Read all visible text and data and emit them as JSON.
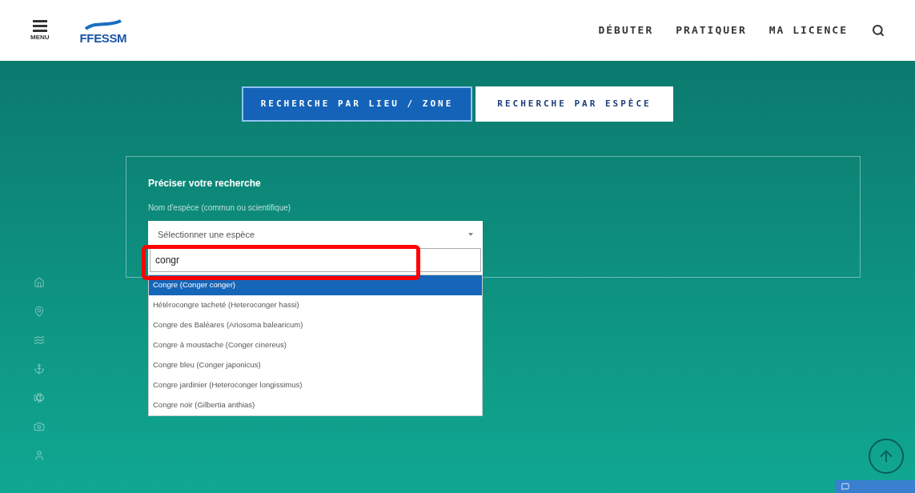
{
  "header": {
    "menu_label": "MENU",
    "logo_text": "FFESSM",
    "nav": [
      "DÉBUTER",
      "PRATIQUER",
      "MA LICENCE"
    ]
  },
  "tabs": [
    {
      "label": "RECHERCHE PAR LIEU / ZONE",
      "selected": true
    },
    {
      "label": "RECHERCHE PAR ESPÈCE",
      "selected": false
    }
  ],
  "panel": {
    "title": "Préciser votre recherche",
    "label": "Nom d'espèce (commun ou scientifique)",
    "select_placeholder": "Sélectionner une espèce",
    "search_value": "congr",
    "highlighted": true,
    "options": [
      {
        "label": "Congre (Conger conger)",
        "selected": true
      },
      {
        "label": "Hétérocongre tacheté (Heteroconger hassi)",
        "selected": false
      },
      {
        "label": "Congre des Baléares (Ariosoma balearicum)",
        "selected": false
      },
      {
        "label": "Congre à moustache (Conger cinereus)",
        "selected": false
      },
      {
        "label": "Congre bleu (Conger japonicus)",
        "selected": false
      },
      {
        "label": "Congre jardinier (Heteroconger longissimus)",
        "selected": false
      },
      {
        "label": "Congre noir (Gilbertia anthias)",
        "selected": false
      }
    ]
  }
}
